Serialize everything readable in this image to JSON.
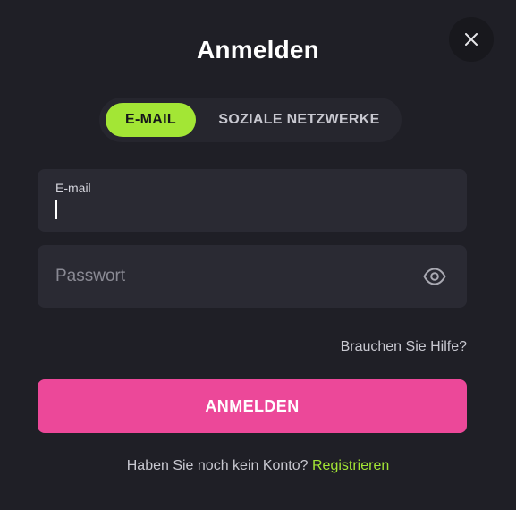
{
  "modal": {
    "title": "Anmelden"
  },
  "tabs": {
    "email_label": "E-MAIL",
    "social_label": "SOZIALE NETZWERKE",
    "active": "email"
  },
  "email_field": {
    "label": "E-mail",
    "value": ""
  },
  "password_field": {
    "placeholder": "Passwort",
    "value": ""
  },
  "help": {
    "label": "Brauchen Sie Hilfe?"
  },
  "submit": {
    "label": "ANMELDEN"
  },
  "register": {
    "prompt": "Haben Sie noch kein Konto?",
    "link_label": "Registrieren"
  },
  "colors": {
    "background": "#1f1f26",
    "accent_green": "#a3e635",
    "accent_pink": "#ec4899",
    "field_bg": "#2a2a33"
  },
  "icons": {
    "close": "close-icon",
    "password_toggle": "eye-icon"
  }
}
